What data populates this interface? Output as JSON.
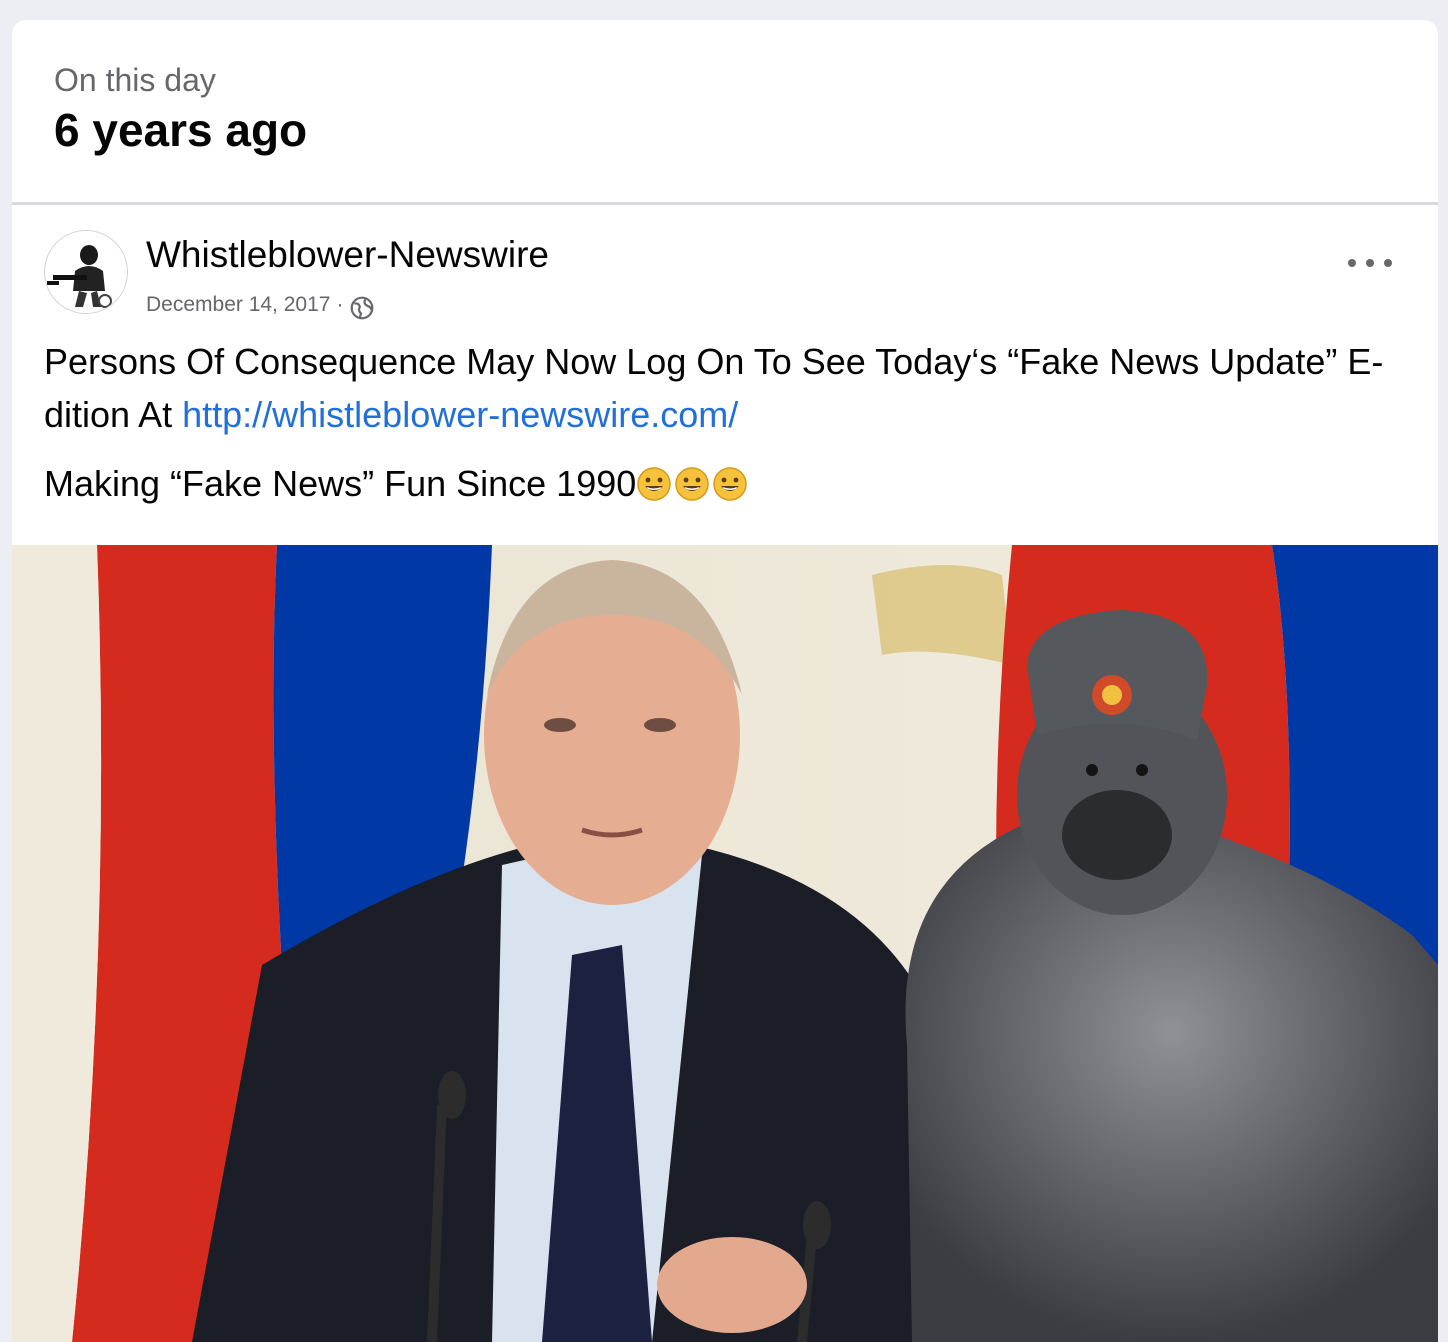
{
  "memory": {
    "label": "On this day",
    "title": "6 years ago"
  },
  "post": {
    "author": "Whistleblower-Newswire",
    "date": "December 14, 2017",
    "separator": "·",
    "text_line1": "Persons Of Consequence May Now Log On To See Today‘s “Fake News Update”  E-dition At ",
    "link": "http://whistleblower-newswire.com/",
    "text_line2": "Making “Fake News” Fun Since 1990",
    "emoji_count": 3,
    "more_icon": "more-horizontal-icon",
    "privacy_icon": "globe-icon"
  },
  "colors": {
    "page_bg": "#eceef3",
    "card_bg": "#ffffff",
    "link": "#216fdb",
    "secondary_text": "#65676b",
    "flag_red": "#d52b1e",
    "flag_blue": "#0039a6"
  }
}
